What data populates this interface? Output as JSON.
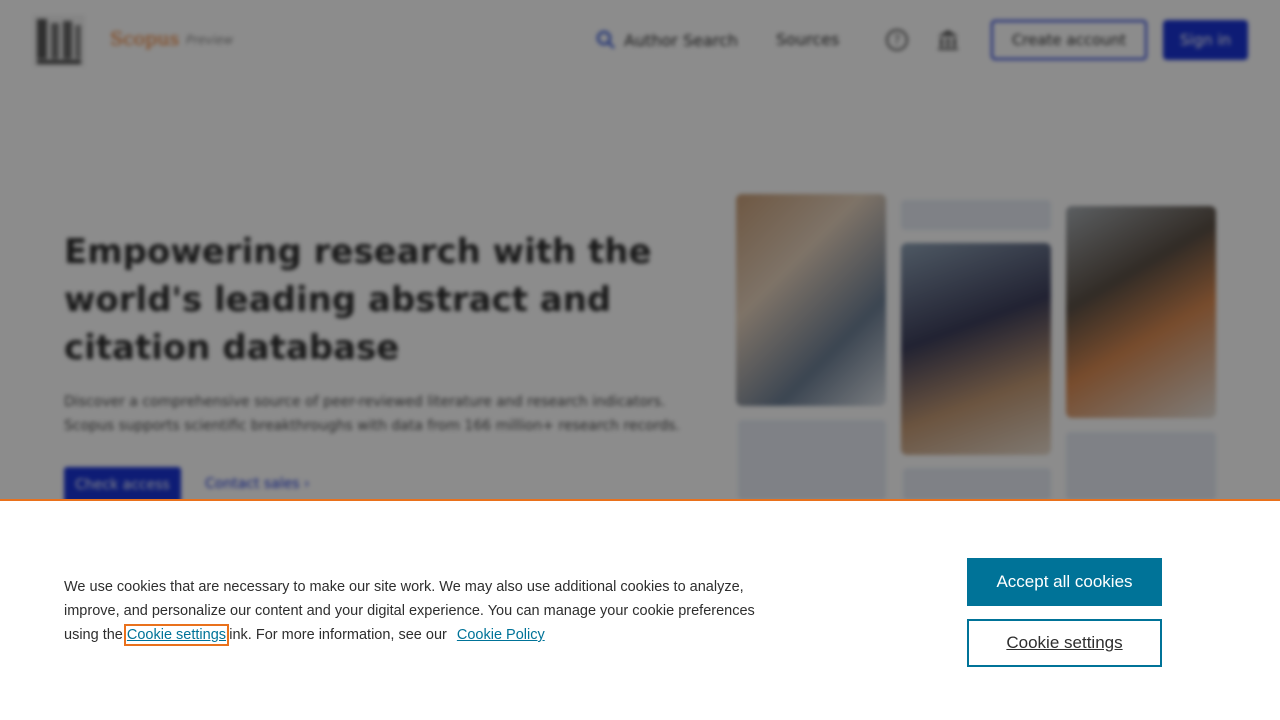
{
  "header": {
    "brand": "Scopus",
    "brand_sub": "Preview",
    "nav": {
      "author_search": "Author Search",
      "sources": "Sources"
    },
    "icons": {
      "search": "search-icon",
      "help": "help-icon",
      "institution": "institution-icon"
    },
    "create_account": "Create account",
    "sign_in": "Sign in"
  },
  "hero": {
    "title": "Empowering research with the world's leading abstract and citation database",
    "description": "Discover a comprehensive source of peer-reviewed literature and research indicators. Scopus supports scientific breakthroughs with data from 166 million+ research records.",
    "check_access": "Check access",
    "contact_sales": "Contact sales"
  },
  "cookie_banner": {
    "text_1": "We use cookies that are necessary to make our site work. We may also use additional cookies to analyze, improve, and personalize our content and your digital experience. You can manage your cookie preferences using the",
    "settings_link": "Cookie settings",
    "text_2": "link. For more information, see our",
    "policy_link": "Cookie Policy",
    "accept_all": "Accept all cookies",
    "cookie_settings": "Cookie settings"
  },
  "colors": {
    "brand_orange": "#e9711c",
    "primary_blue": "#1a34d6",
    "cookie_teal": "#007398"
  }
}
